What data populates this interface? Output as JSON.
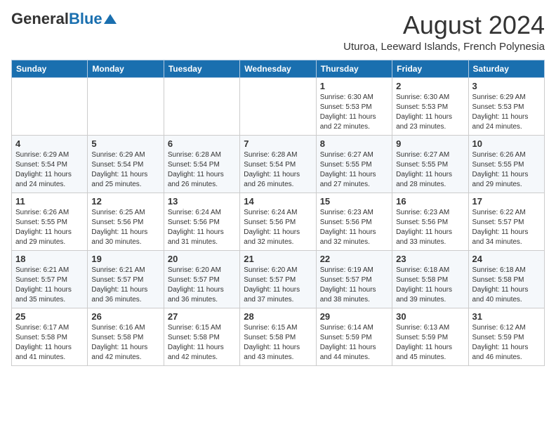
{
  "header": {
    "logo_general": "General",
    "logo_blue": "Blue",
    "month_year": "August 2024",
    "location": "Uturoa, Leeward Islands, French Polynesia"
  },
  "days_of_week": [
    "Sunday",
    "Monday",
    "Tuesday",
    "Wednesday",
    "Thursday",
    "Friday",
    "Saturday"
  ],
  "weeks": [
    [
      {
        "day": "",
        "info": ""
      },
      {
        "day": "",
        "info": ""
      },
      {
        "day": "",
        "info": ""
      },
      {
        "day": "",
        "info": ""
      },
      {
        "day": "1",
        "info": "Sunrise: 6:30 AM\nSunset: 5:53 PM\nDaylight: 11 hours and 22 minutes."
      },
      {
        "day": "2",
        "info": "Sunrise: 6:30 AM\nSunset: 5:53 PM\nDaylight: 11 hours and 23 minutes."
      },
      {
        "day": "3",
        "info": "Sunrise: 6:29 AM\nSunset: 5:53 PM\nDaylight: 11 hours and 24 minutes."
      }
    ],
    [
      {
        "day": "4",
        "info": "Sunrise: 6:29 AM\nSunset: 5:54 PM\nDaylight: 11 hours and 24 minutes."
      },
      {
        "day": "5",
        "info": "Sunrise: 6:29 AM\nSunset: 5:54 PM\nDaylight: 11 hours and 25 minutes."
      },
      {
        "day": "6",
        "info": "Sunrise: 6:28 AM\nSunset: 5:54 PM\nDaylight: 11 hours and 26 minutes."
      },
      {
        "day": "7",
        "info": "Sunrise: 6:28 AM\nSunset: 5:54 PM\nDaylight: 11 hours and 26 minutes."
      },
      {
        "day": "8",
        "info": "Sunrise: 6:27 AM\nSunset: 5:55 PM\nDaylight: 11 hours and 27 minutes."
      },
      {
        "day": "9",
        "info": "Sunrise: 6:27 AM\nSunset: 5:55 PM\nDaylight: 11 hours and 28 minutes."
      },
      {
        "day": "10",
        "info": "Sunrise: 6:26 AM\nSunset: 5:55 PM\nDaylight: 11 hours and 29 minutes."
      }
    ],
    [
      {
        "day": "11",
        "info": "Sunrise: 6:26 AM\nSunset: 5:55 PM\nDaylight: 11 hours and 29 minutes."
      },
      {
        "day": "12",
        "info": "Sunrise: 6:25 AM\nSunset: 5:56 PM\nDaylight: 11 hours and 30 minutes."
      },
      {
        "day": "13",
        "info": "Sunrise: 6:24 AM\nSunset: 5:56 PM\nDaylight: 11 hours and 31 minutes."
      },
      {
        "day": "14",
        "info": "Sunrise: 6:24 AM\nSunset: 5:56 PM\nDaylight: 11 hours and 32 minutes."
      },
      {
        "day": "15",
        "info": "Sunrise: 6:23 AM\nSunset: 5:56 PM\nDaylight: 11 hours and 32 minutes."
      },
      {
        "day": "16",
        "info": "Sunrise: 6:23 AM\nSunset: 5:56 PM\nDaylight: 11 hours and 33 minutes."
      },
      {
        "day": "17",
        "info": "Sunrise: 6:22 AM\nSunset: 5:57 PM\nDaylight: 11 hours and 34 minutes."
      }
    ],
    [
      {
        "day": "18",
        "info": "Sunrise: 6:21 AM\nSunset: 5:57 PM\nDaylight: 11 hours and 35 minutes."
      },
      {
        "day": "19",
        "info": "Sunrise: 6:21 AM\nSunset: 5:57 PM\nDaylight: 11 hours and 36 minutes."
      },
      {
        "day": "20",
        "info": "Sunrise: 6:20 AM\nSunset: 5:57 PM\nDaylight: 11 hours and 36 minutes."
      },
      {
        "day": "21",
        "info": "Sunrise: 6:20 AM\nSunset: 5:57 PM\nDaylight: 11 hours and 37 minutes."
      },
      {
        "day": "22",
        "info": "Sunrise: 6:19 AM\nSunset: 5:57 PM\nDaylight: 11 hours and 38 minutes."
      },
      {
        "day": "23",
        "info": "Sunrise: 6:18 AM\nSunset: 5:58 PM\nDaylight: 11 hours and 39 minutes."
      },
      {
        "day": "24",
        "info": "Sunrise: 6:18 AM\nSunset: 5:58 PM\nDaylight: 11 hours and 40 minutes."
      }
    ],
    [
      {
        "day": "25",
        "info": "Sunrise: 6:17 AM\nSunset: 5:58 PM\nDaylight: 11 hours and 41 minutes."
      },
      {
        "day": "26",
        "info": "Sunrise: 6:16 AM\nSunset: 5:58 PM\nDaylight: 11 hours and 42 minutes."
      },
      {
        "day": "27",
        "info": "Sunrise: 6:15 AM\nSunset: 5:58 PM\nDaylight: 11 hours and 42 minutes."
      },
      {
        "day": "28",
        "info": "Sunrise: 6:15 AM\nSunset: 5:58 PM\nDaylight: 11 hours and 43 minutes."
      },
      {
        "day": "29",
        "info": "Sunrise: 6:14 AM\nSunset: 5:59 PM\nDaylight: 11 hours and 44 minutes."
      },
      {
        "day": "30",
        "info": "Sunrise: 6:13 AM\nSunset: 5:59 PM\nDaylight: 11 hours and 45 minutes."
      },
      {
        "day": "31",
        "info": "Sunrise: 6:12 AM\nSunset: 5:59 PM\nDaylight: 11 hours and 46 minutes."
      }
    ]
  ]
}
